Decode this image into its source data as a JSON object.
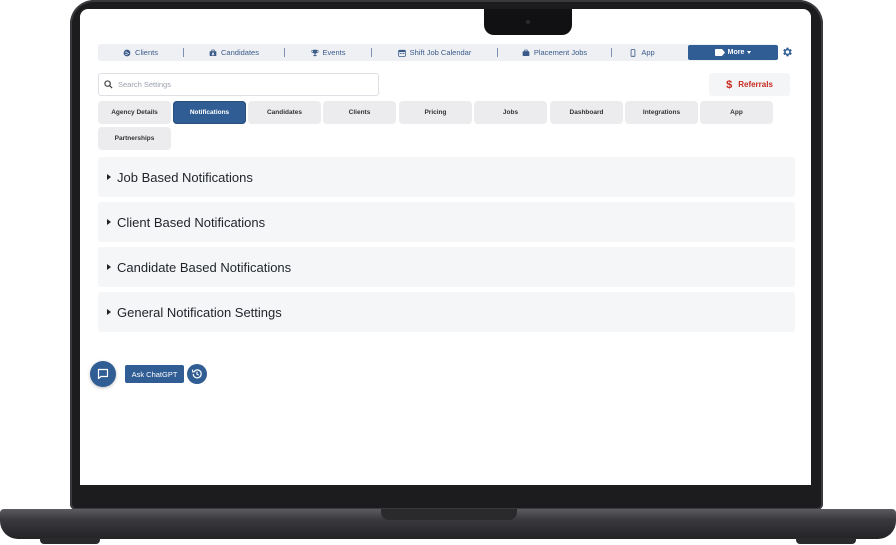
{
  "topnav": {
    "items": [
      {
        "label": "Clients",
        "icon": "globe-icon"
      },
      {
        "label": "Candidates",
        "icon": "briefcase-user-icon"
      },
      {
        "label": "Events",
        "icon": "trophy-icon"
      },
      {
        "label": "Shift Job Calendar",
        "icon": "calendar-icon"
      },
      {
        "label": "Placement Jobs",
        "icon": "briefcase-icon"
      },
      {
        "label": "App",
        "icon": "mobile-icon"
      }
    ],
    "more_label": "More",
    "accent": "#2f5d94"
  },
  "search": {
    "placeholder": "Search Settings",
    "value": ""
  },
  "referrals": {
    "label": "Referrals",
    "symbol": "$",
    "color": "#c8291f"
  },
  "tabs": [
    {
      "label": "Agency Details",
      "active": false
    },
    {
      "label": "Notifications",
      "active": true
    },
    {
      "label": "Candidates",
      "active": false
    },
    {
      "label": "Clients",
      "active": false
    },
    {
      "label": "Pricing",
      "active": false
    },
    {
      "label": "Jobs",
      "active": false
    },
    {
      "label": "Dashboard",
      "active": false
    },
    {
      "label": "Integrations",
      "active": false
    },
    {
      "label": "App",
      "active": false
    },
    {
      "label": "Partnerships",
      "active": false
    }
  ],
  "sections": [
    {
      "title": "Job Based Notifications"
    },
    {
      "title": "Client Based Notifications"
    },
    {
      "title": "Candidate Based Notifications"
    },
    {
      "title": "General Notification Settings"
    }
  ],
  "chat": {
    "ask_label": "Ask ChatGPT"
  }
}
